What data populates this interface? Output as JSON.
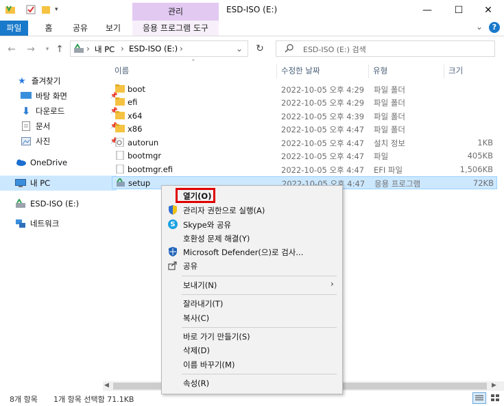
{
  "window": {
    "title": "ESD-ISO (E:)",
    "context_tab": "관리",
    "minimize_glyph": "—",
    "maximize_glyph": "☐",
    "close_glyph": "✕",
    "help_glyph": "?",
    "expand_glyph": "⌄"
  },
  "ribbon": {
    "tabs": [
      "파일",
      "홈",
      "공유",
      "보기",
      "응용 프로그램 도구"
    ]
  },
  "address": {
    "crumbs": [
      "내 PC",
      "ESD-ISO (E:)"
    ],
    "sep": "›",
    "search_placeholder": "ESD-ISO (E:) 검색"
  },
  "nav": {
    "quick_access": "즐겨찾기",
    "items": [
      {
        "label": "바탕 화면",
        "pinned": true
      },
      {
        "label": "다운로드",
        "pinned": true
      },
      {
        "label": "문서",
        "pinned": true
      },
      {
        "label": "사진",
        "pinned": true
      }
    ],
    "onedrive": "OneDrive",
    "this_pc": "내 PC",
    "drive": "ESD-ISO (E:)",
    "network": "네트워크"
  },
  "columns": {
    "name": "이름",
    "date": "수정한 날짜",
    "type": "유형",
    "size": "크기"
  },
  "files": [
    {
      "name": "boot",
      "date": "2022-10-05 오후 4:29",
      "type": "파일 폴더",
      "size": "",
      "icon": "folder"
    },
    {
      "name": "efi",
      "date": "2022-10-05 오후 4:29",
      "type": "파일 폴더",
      "size": "",
      "icon": "folder"
    },
    {
      "name": "x64",
      "date": "2022-10-05 오후 4:39",
      "type": "파일 폴더",
      "size": "",
      "icon": "folder"
    },
    {
      "name": "x86",
      "date": "2022-10-05 오후 4:47",
      "type": "파일 폴더",
      "size": "",
      "icon": "folder"
    },
    {
      "name": "autorun",
      "date": "2022-10-05 오후 4:47",
      "type": "설치 정보",
      "size": "1KB",
      "icon": "settings-file"
    },
    {
      "name": "bootmgr",
      "date": "2022-10-05 오후 4:47",
      "type": "파일",
      "size": "405KB",
      "icon": "file"
    },
    {
      "name": "bootmgr.efi",
      "date": "2022-10-05 오후 4:47",
      "type": "EFI 파일",
      "size": "1,506KB",
      "icon": "file"
    },
    {
      "name": "setup",
      "date": "2022-10-05 오후 4:47",
      "type": "응용 프로그램",
      "size": "72KB",
      "icon": "setup-app"
    }
  ],
  "context_menu": {
    "open": "열기(O)",
    "run_admin": "관리자 권한으로 실행(A)",
    "skype_share": "Skype와 공유",
    "compat": "호환성 문제 해결(Y)",
    "defender": "Microsoft Defender(으)로 검사...",
    "share": "공유",
    "send_to": "보내기(N)",
    "cut": "잘라내기(T)",
    "copy": "복사(C)",
    "shortcut": "바로 가기 만들기(S)",
    "delete": "삭제(D)",
    "rename": "이름 바꾸기(M)",
    "properties": "속성(R)"
  },
  "status": {
    "count": "8개 항목",
    "selection": "1개 항목 선택함 71.1KB"
  },
  "colors": {
    "accent": "#1979ca",
    "context_tab": "#e2c9f2",
    "selection": "#cce8ff",
    "highlight_box": "#e00000"
  }
}
